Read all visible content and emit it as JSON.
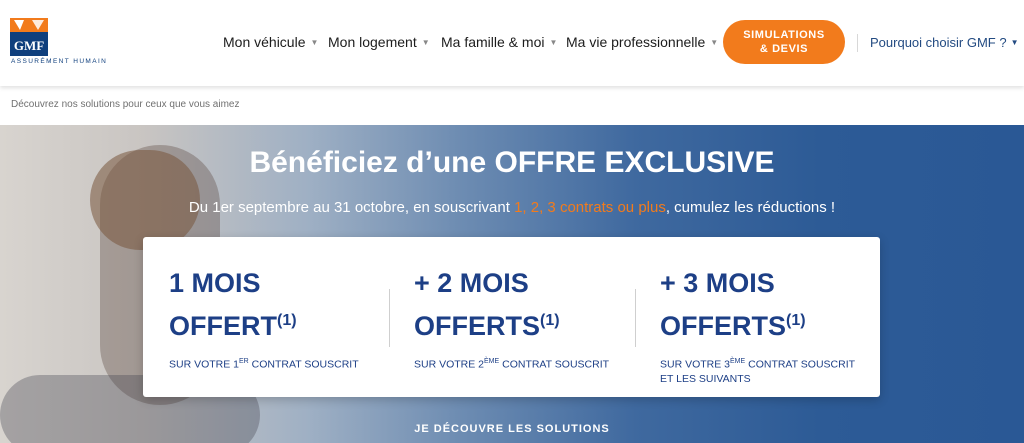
{
  "brand": {
    "name": "GMF",
    "tagline": "ASSURÉMENT HUMAIN",
    "color": "#0f3f7d",
    "accent": "#f27b1c"
  },
  "nav": {
    "items": [
      {
        "label": "Mon véhicule"
      },
      {
        "label": "Mon logement"
      },
      {
        "label": "Ma famille & moi"
      },
      {
        "label": "Ma vie professionnelle"
      }
    ],
    "cta": {
      "line1": "SIMULATIONS",
      "line2": "& DEVIS"
    },
    "why": "Pourquoi choisir GMF ?"
  },
  "breadcrumb": "Découvrez nos solutions pour ceux que vous aimez",
  "hero": {
    "title": "Bénéficiez d’une OFFRE EXCLUSIVE",
    "subtitle_before": "Du 1er septembre au 31 octobre, en souscrivant ",
    "subtitle_highlight": "1, 2, 3 contrats ou plus",
    "subtitle_after": ", cumulez les réductions !",
    "offers": [
      {
        "line1": "1 MOIS",
        "line2": "OFFERT",
        "note": "(1)",
        "desc_pre": "SUR VOTRE 1",
        "desc_sup": "ER",
        "desc_post": " CONTRAT SOUSCRIT"
      },
      {
        "line1": "+ 2 MOIS",
        "line2": "OFFERTS",
        "note": "(1)",
        "desc_pre": "SUR VOTRE 2",
        "desc_sup": "ÈME",
        "desc_post": " CONTRAT SOUSCRIT"
      },
      {
        "line1": "+ 3 MOIS",
        "line2": "OFFERTS",
        "note": "(1)",
        "desc_pre": "SUR VOTRE 3",
        "desc_sup": "ÈME",
        "desc_post": " CONTRAT SOUSCRIT ET LES SUIVANTS"
      }
    ],
    "discover": "JE DÉCOUVRE LES SOLUTIONS"
  }
}
